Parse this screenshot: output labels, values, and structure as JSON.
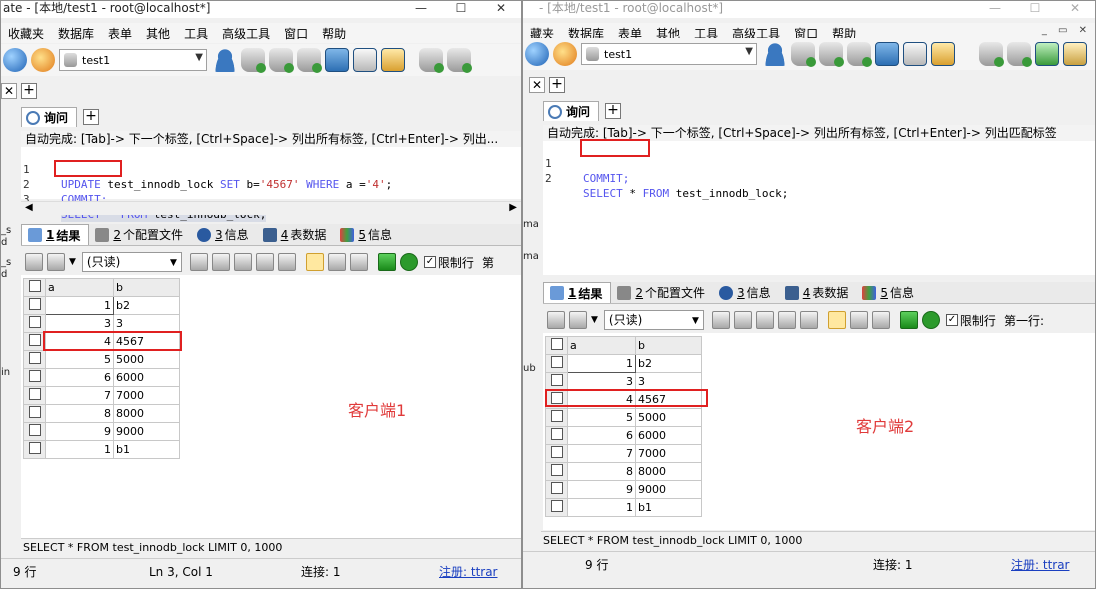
{
  "client1": {
    "title": "ate - [本地/test1 - root@localhost*]",
    "menu": [
      "收藏夹",
      "数据库",
      "表单",
      "其他",
      "工具",
      "高级工具",
      "窗口",
      "帮助"
    ],
    "db_selector": "test1",
    "query_tab": "询问",
    "autocomplete": "自动完成: [Tab]-> 下一个标签, [Ctrl+Space]-> 列出所有标签, [Ctrl+Enter]-> 列出...",
    "code_lines": [
      {
        "num": "1",
        "text": "UPDATE test_innodb_lock SET b='4567' WHERE a ='4';"
      },
      {
        "num": "2",
        "text": "COMMIT;"
      },
      {
        "num": "3",
        "text": "SELECT * FROM test_innodb_lock;"
      }
    ],
    "result_tabs": [
      {
        "num": "1",
        "label": "结果"
      },
      {
        "num": "2",
        "label": "个配置文件"
      },
      {
        "num": "3",
        "label": "信息"
      },
      {
        "num": "4",
        "label": "表数据"
      },
      {
        "num": "5",
        "label": "信息"
      }
    ],
    "readonly_label": "(只读)",
    "limit_label": "限制行",
    "extra_label": "第",
    "columns": [
      "a",
      "b"
    ],
    "rows": [
      [
        "1",
        "b2"
      ],
      [
        "3",
        "3"
      ],
      [
        "4",
        "4567"
      ],
      [
        "5",
        "5000"
      ],
      [
        "6",
        "6000"
      ],
      [
        "7",
        "7000"
      ],
      [
        "8",
        "8000"
      ],
      [
        "9",
        "9000"
      ],
      [
        "1",
        "b1"
      ]
    ],
    "client_label": "客户端1",
    "sql_status": "SELECT * FROM test_innodb_lock LIMIT 0, 1000",
    "status": {
      "rows": "9 行",
      "pos": "Ln 3, Col 1",
      "conn": "连接: 1",
      "reg": "注册: ttrar"
    },
    "left_stubs": [
      "_s",
      "d",
      "_s",
      "d",
      "in"
    ]
  },
  "client2": {
    "title": "- [本地/test1 - root@localhost*]",
    "menu": [
      "藏夹",
      "数据库",
      "表单",
      "其他",
      "工具",
      "高级工具",
      "窗口",
      "帮助"
    ],
    "db_selector": "test1",
    "query_tab": "询问",
    "autocomplete": "自动完成: [Tab]-> 下一个标签, [Ctrl+Space]-> 列出所有标签, [Ctrl+Enter]-> 列出匹配标签",
    "code_lines": [
      {
        "num": "1",
        "text": "COMMIT;"
      },
      {
        "num": "2",
        "text": "SELECT * FROM test_innodb_lock;"
      }
    ],
    "result_tabs": [
      {
        "num": "1",
        "label": "结果"
      },
      {
        "num": "2",
        "label": "个配置文件"
      },
      {
        "num": "3",
        "label": "信息"
      },
      {
        "num": "4",
        "label": "表数据"
      },
      {
        "num": "5",
        "label": "信息"
      }
    ],
    "readonly_label": "(只读)",
    "limit_label": "限制行",
    "extra_label": "第一行:",
    "columns": [
      "a",
      "b"
    ],
    "rows": [
      [
        "1",
        "b2"
      ],
      [
        "3",
        "3"
      ],
      [
        "4",
        "4567"
      ],
      [
        "5",
        "5000"
      ],
      [
        "6",
        "6000"
      ],
      [
        "7",
        "7000"
      ],
      [
        "8",
        "8000"
      ],
      [
        "9",
        "9000"
      ],
      [
        "1",
        "b1"
      ]
    ],
    "client_label": "客户端2",
    "sql_status": "SELECT * FROM test_innodb_lock LIMIT 0, 1000",
    "status": {
      "rows": "9 行",
      "conn": "连接: 1",
      "reg": "注册: ttrar"
    },
    "left_stubs": [
      "ma",
      "ma",
      "ub"
    ]
  },
  "colors": {
    "highlight_box": "#e02020",
    "annotation": "#e03a3a",
    "keyword": "#5555ee",
    "string": "#c03030"
  }
}
